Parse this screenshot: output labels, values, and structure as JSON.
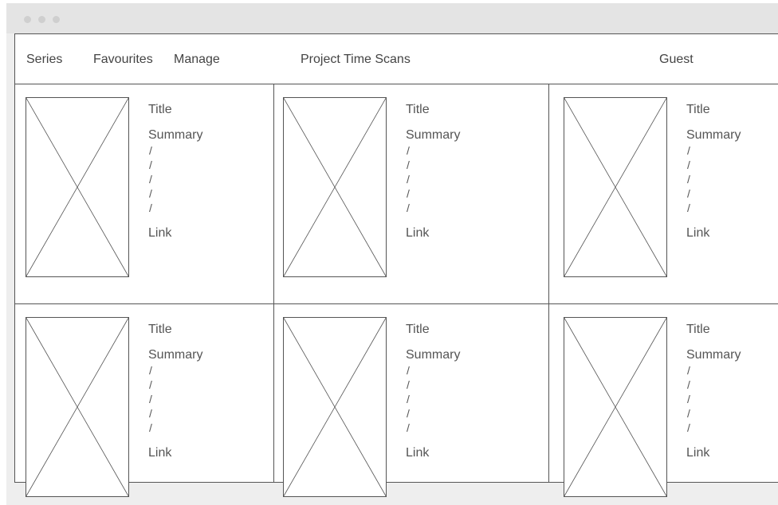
{
  "nav": {
    "series": "Series",
    "favourites": "Favourites",
    "manage": "Manage",
    "app_title": "Project Time Scans",
    "user": "Guest"
  },
  "cards": [
    {
      "title": "Title",
      "summary": "Summary",
      "lines": [
        "/",
        "/",
        "/",
        "/",
        "/"
      ],
      "link": "Link",
      "image_icon": "image-placeholder-icon"
    },
    {
      "title": "Title",
      "summary": "Summary",
      "lines": [
        "/",
        "/",
        "/",
        "/",
        "/"
      ],
      "link": "Link",
      "image_icon": "image-placeholder-icon"
    },
    {
      "title": "Title",
      "summary": "Summary",
      "lines": [
        "/",
        "/",
        "/",
        "/",
        "/"
      ],
      "link": "Link",
      "image_icon": "image-placeholder-icon"
    },
    {
      "title": "Title",
      "summary": "Summary",
      "lines": [
        "/",
        "/",
        "/",
        "/",
        "/"
      ],
      "link": "Link",
      "image_icon": "image-placeholder-icon"
    },
    {
      "title": "Title",
      "summary": "Summary",
      "lines": [
        "/",
        "/",
        "/",
        "/",
        "/"
      ],
      "link": "Link",
      "image_icon": "image-placeholder-icon"
    },
    {
      "title": "Title",
      "summary": "Summary",
      "lines": [
        "/",
        "/",
        "/",
        "/",
        "/"
      ],
      "link": "Link",
      "image_icon": "image-placeholder-icon"
    }
  ],
  "colors": {
    "border": "#555555",
    "window": "#eeeeee",
    "titlebar": "#e4e4e4",
    "dots": "#cfcfcf"
  }
}
